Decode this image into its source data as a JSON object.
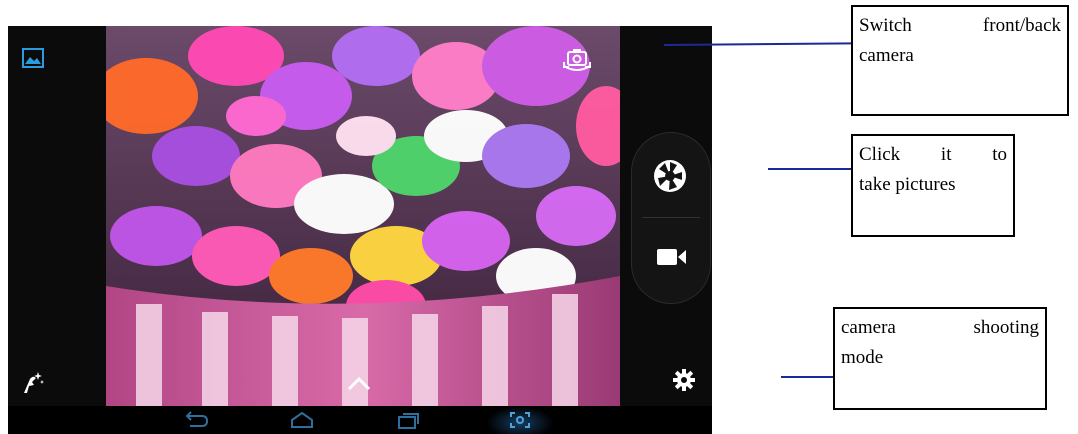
{
  "camera": {
    "icons": {
      "gallery": "gallery-icon",
      "switch_camera": "switch-camera-icon",
      "shutter": "shutter-icon",
      "video": "video-camera-icon",
      "effects": "effects-icon",
      "expand": "chevron-up-icon",
      "settings": "gear-icon"
    },
    "nav_bar": [
      "back-icon",
      "home-icon",
      "recent-apps-icon",
      "screenshot-icon"
    ],
    "accent": "#2b9be0"
  },
  "annotations": {
    "switch_camera": {
      "line1": "Switch front/back",
      "line2": "camera"
    },
    "take_picture": {
      "line1": "Click it to",
      "line2": "take pictures"
    },
    "shooting_mode": {
      "line1": "camera shooting",
      "line2": "mode"
    }
  },
  "colors": {
    "leader_line": "#1a2a9a",
    "callout_border": "#000000"
  }
}
